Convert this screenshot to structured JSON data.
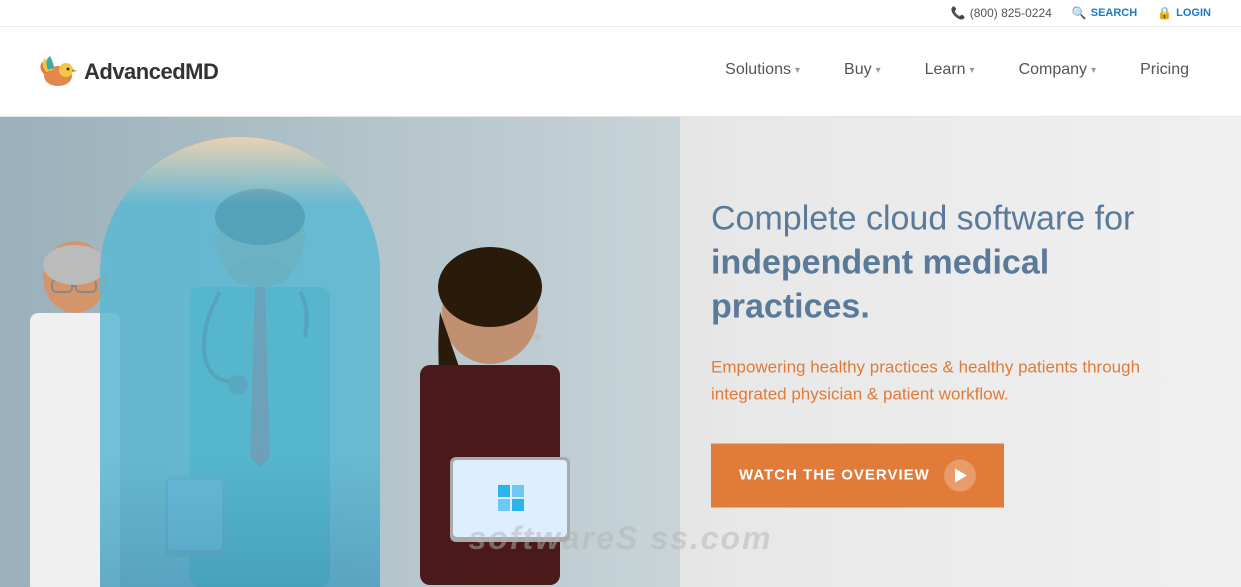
{
  "topbar": {
    "phone": "(800) 825-0224",
    "search": "SEARCH",
    "login": "LOGIN"
  },
  "logo": {
    "text_regular": "Advanced",
    "text_bold": "MD"
  },
  "nav": {
    "items": [
      {
        "label": "Solutions",
        "has_dropdown": true
      },
      {
        "label": "Buy",
        "has_dropdown": true
      },
      {
        "label": "Learn",
        "has_dropdown": true
      },
      {
        "label": "Company",
        "has_dropdown": true
      },
      {
        "label": "Pricing",
        "has_dropdown": false
      }
    ]
  },
  "hero": {
    "headline_line1": "Complete cloud software for",
    "headline_line2": "independent medical practices.",
    "subtext": "Empowering healthy practices & healthy patients through integrated physician & patient workflow.",
    "cta_label": "WATCH THE OVERVIEW",
    "watermark": "softwareS    ss.com"
  }
}
